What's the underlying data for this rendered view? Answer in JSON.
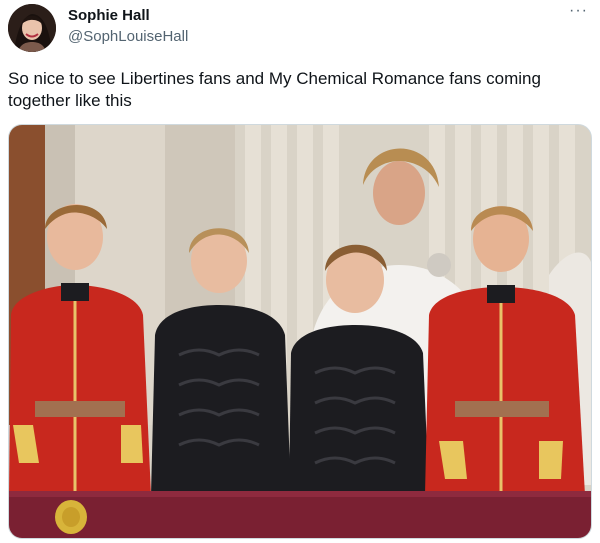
{
  "tweet": {
    "display_name": "Sophie Hall",
    "handle": "@SophLouiseHall",
    "more_label": "···",
    "text": "So nice to see Libertines fans and My Chemical Romance fans coming together like this"
  },
  "icons": {
    "avatar": "profile-photo",
    "more": "more-options-icon"
  },
  "colors": {
    "text_primary": "#0f1419",
    "text_secondary": "#536471",
    "uniform_red": "#c8281e",
    "uniform_black": "#1c1c20",
    "balcony_drape": "#7a2032"
  }
}
